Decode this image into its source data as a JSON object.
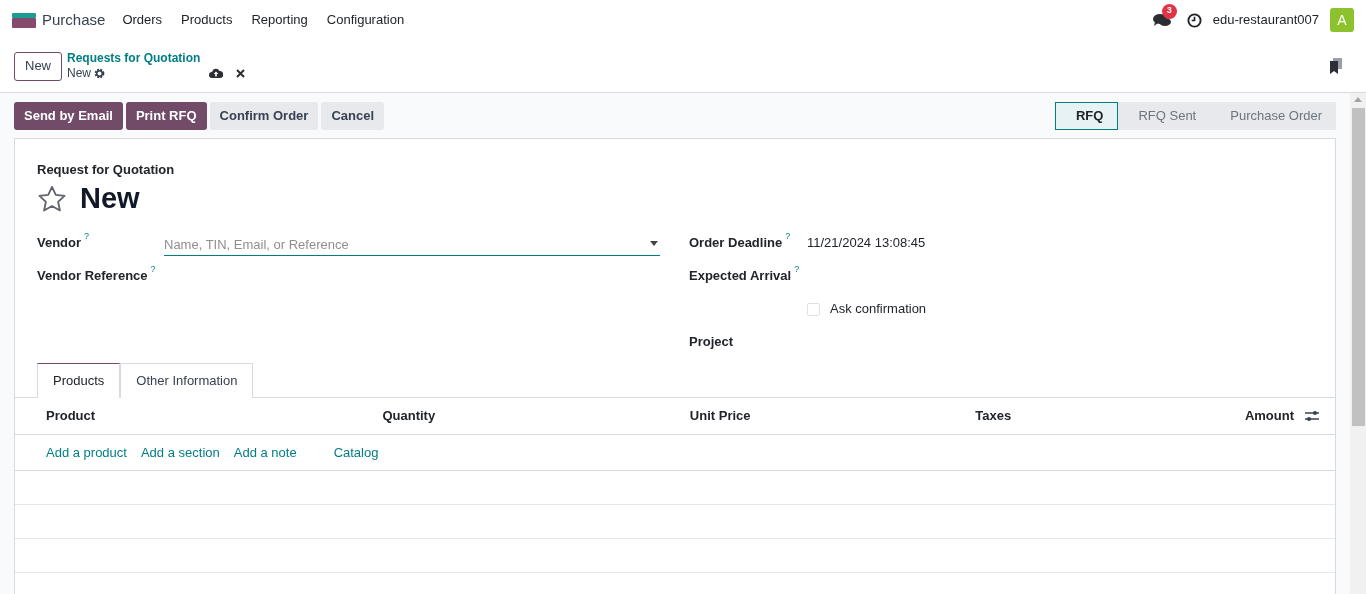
{
  "app": {
    "name": "Purchase"
  },
  "menu": [
    "Orders",
    "Products",
    "Reporting",
    "Configuration"
  ],
  "systray": {
    "messages_count": "3",
    "user": "edu-restaurant007",
    "avatar_letter": "A"
  },
  "control_panel": {
    "new_button": "New",
    "breadcrumb": "Requests for Quotation",
    "record": "New"
  },
  "actions": [
    {
      "label": "Send by Email",
      "kind": "primary"
    },
    {
      "label": "Print RFQ",
      "kind": "primary"
    },
    {
      "label": "Confirm Order",
      "kind": "secondary"
    },
    {
      "label": "Cancel",
      "kind": "secondary"
    }
  ],
  "statusbar": [
    {
      "label": "RFQ",
      "selected": true
    },
    {
      "label": "RFQ Sent",
      "selected": false
    },
    {
      "label": "Purchase Order",
      "selected": false
    }
  ],
  "form": {
    "subtitle": "Request for Quotation",
    "title": "New",
    "starred": false,
    "left_fields": [
      {
        "kind": "input",
        "label": "Vendor",
        "help": "?",
        "placeholder": "Name, TIN, Email, or Reference"
      },
      {
        "kind": "empty",
        "label": "Vendor Reference",
        "help": "?"
      }
    ],
    "right_fields": [
      {
        "kind": "text",
        "label": "Order Deadline",
        "help": "?",
        "value": "11/21/2024 13:08:45"
      },
      {
        "kind": "empty",
        "label": "Expected Arrival",
        "help": "?"
      },
      {
        "kind": "checkbox",
        "label": "Ask confirmation",
        "checked": false
      },
      {
        "kind": "empty",
        "label": "Project"
      }
    ],
    "tabs": [
      {
        "label": "Products",
        "selected": true
      },
      {
        "label": "Other Information",
        "selected": false
      }
    ],
    "table": {
      "columns": [
        "Product",
        "Quantity",
        "Unit Price",
        "Taxes",
        "Amount"
      ],
      "add_links": [
        "Add a product",
        "Add a section",
        "Add a note",
        "Catalog"
      ]
    }
  }
}
